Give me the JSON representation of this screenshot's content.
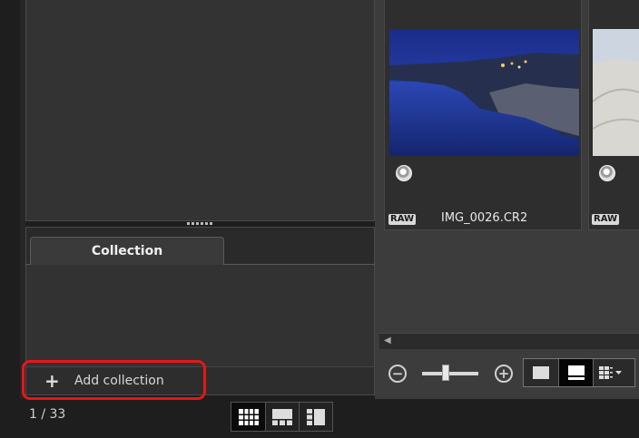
{
  "collection_panel": {
    "tab_label": "Collection",
    "add_collection_label": "Add collection"
  },
  "status_bar": {
    "page_counter": "1 / 33"
  },
  "thumbnails": [
    {
      "badge": "RAW",
      "filename": "IMG_0026.CR2"
    },
    {
      "badge": "RAW",
      "filename": ""
    }
  ],
  "icons": {
    "plus": "plus-icon",
    "layout_grid": "grid-layout-icon",
    "layout_preview": "preview-layout-icon",
    "layout_split": "split-layout-icon",
    "zoom_out": "zoom-out-icon",
    "zoom_in": "zoom-in-icon",
    "rating": "rating-icon"
  },
  "colors": {
    "highlight": "#e5161b",
    "panel_bg": "#333333",
    "background": "#1e1e1e"
  }
}
